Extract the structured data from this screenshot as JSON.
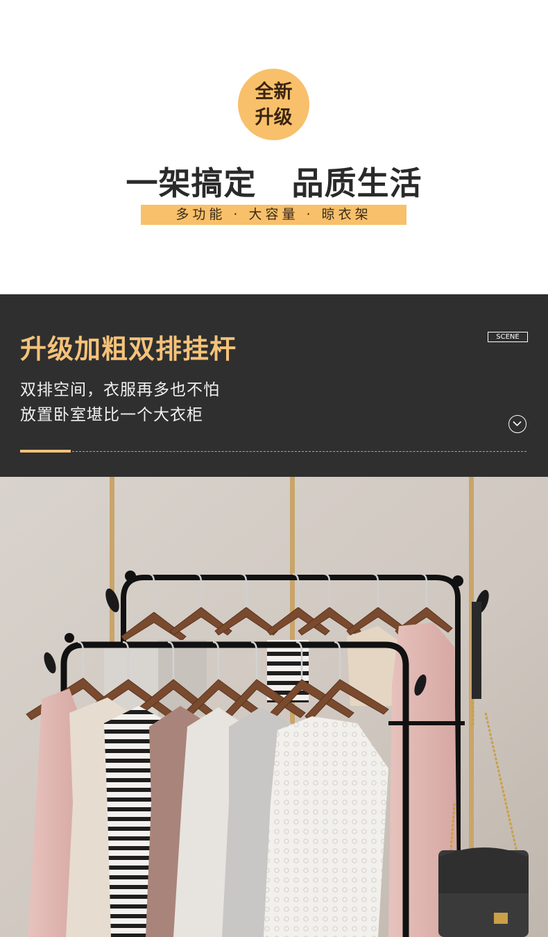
{
  "badge": {
    "line1": "全新",
    "line2": "升级"
  },
  "headline": "一架搞定   品质生活",
  "tagline": "多功能 · 大容量 · 晾衣架",
  "feature": {
    "title": "升级加粗双排挂杆",
    "scene_label": "SCENE",
    "desc_line1": "双排空间，衣服再多也不怕",
    "desc_line2": "放置卧室堪比一个大衣柜",
    "expand_icon": "chevron-down-circle-icon"
  },
  "colors": {
    "accent": "#f8c06a",
    "title_gold": "#f5c27a",
    "dark_panel": "#2f2f2f",
    "rack": "#111111",
    "hanger": "#7a4a2e"
  },
  "photo": {
    "subject": "double-rail-clothes-rack",
    "icons": [
      "clothes-rack",
      "hanger-icon",
      "handbag-icon"
    ]
  }
}
